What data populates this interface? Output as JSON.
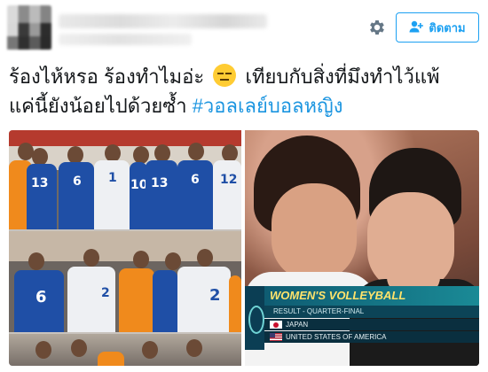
{
  "header": {
    "follow_label": "ติดตาม",
    "settings_icon": "gear-icon",
    "follow_icon": "add-user-icon"
  },
  "tweet": {
    "line1_before_emoji": "ร้องไห้หรอ ร้องทำไมอ่ะ",
    "emoji": "unamused-face",
    "line1_after_emoji": "เทียบกับสิ่งที่มึงทำไว้แพ้",
    "line2_text": "แค่นี้ยังน้อยไปด้วยซ้ำ",
    "hashtag": "#วอลเลย์บอลหญิง"
  },
  "media": {
    "left_image": {
      "jersey_numbers_row1": [
        "13",
        "6",
        "1",
        "10",
        "13",
        "6",
        "12"
      ],
      "jersey_numbers_row2": [
        "6",
        "2",
        "2"
      ]
    },
    "right_image": {
      "broadcast": {
        "title": "WOMEN'S VOLLEYBALL",
        "subtitle": "RESULT - QUARTER-FINAL",
        "team1": "JAPAN",
        "team2": "UNITED STATES OF AMERICA"
      }
    }
  },
  "colors": {
    "accent": "#1da1f2",
    "hashtag": "#1b95e0",
    "text": "#14171a"
  }
}
